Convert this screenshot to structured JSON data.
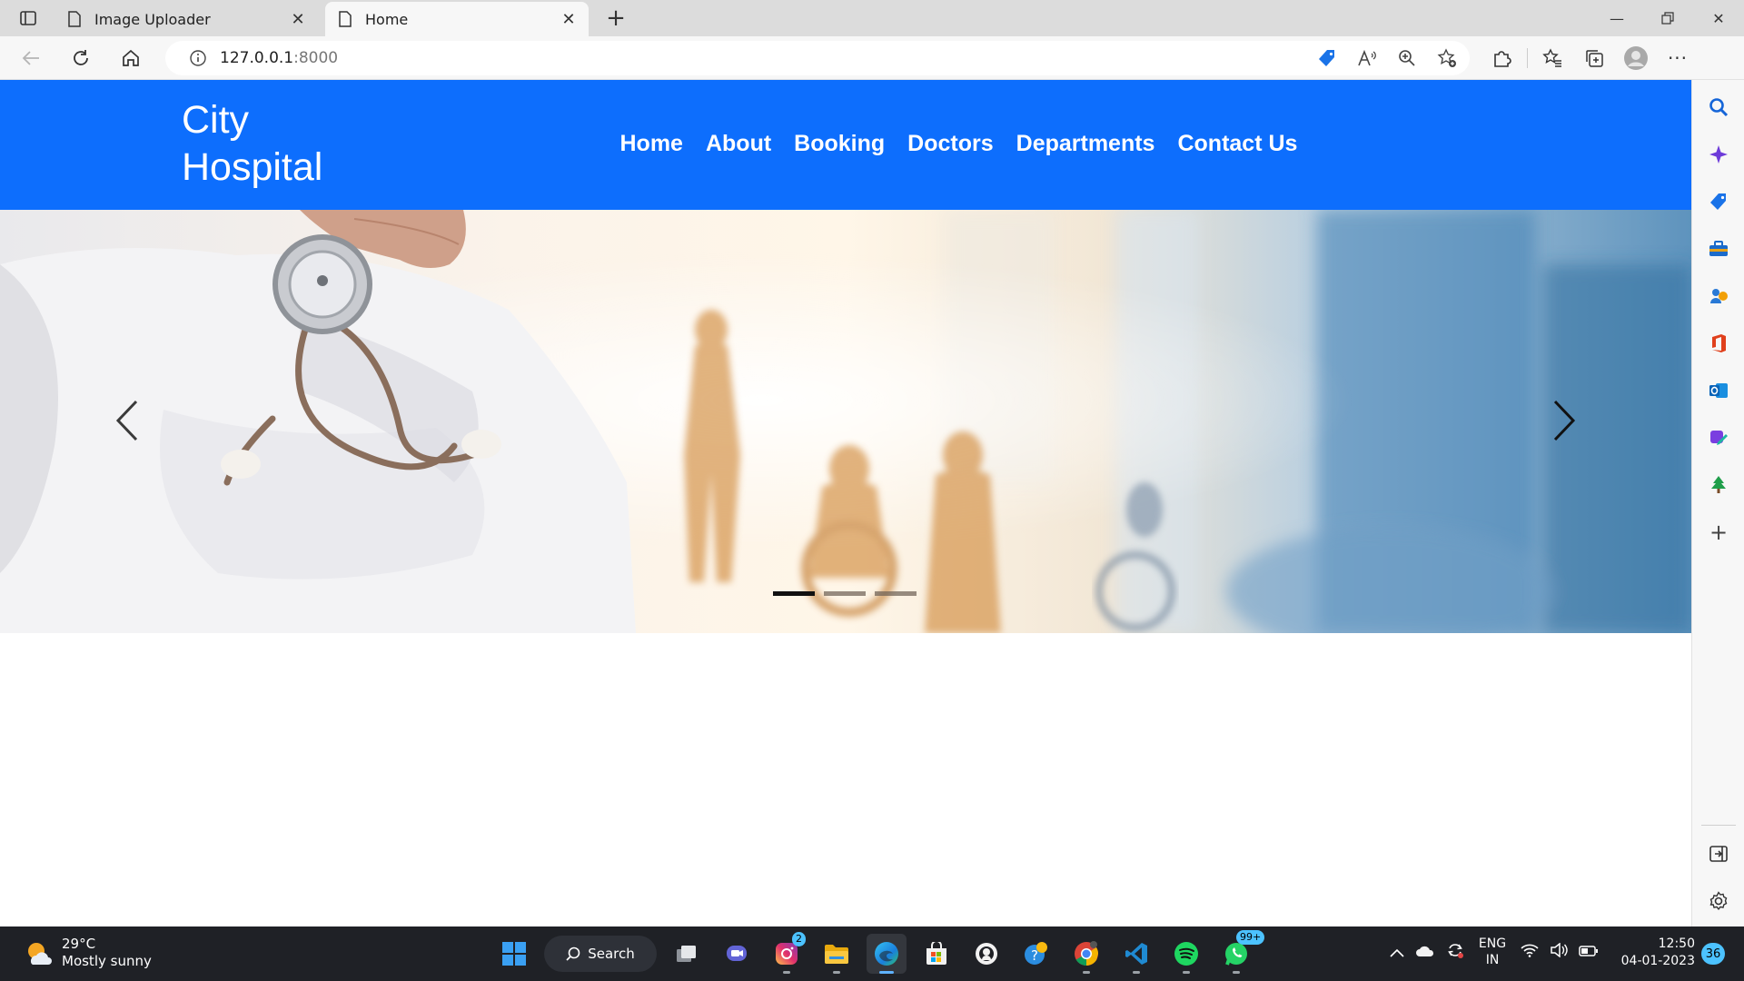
{
  "browser": {
    "tabs": [
      {
        "title": "Image Uploader",
        "active": false
      },
      {
        "title": "Home",
        "active": true
      }
    ],
    "address": {
      "host": "127.0.0.1",
      "port": ":8000"
    },
    "sidebar_icons": [
      "search-icon",
      "copilot-icon",
      "shopping-tag-icon",
      "tools-icon",
      "games-icon",
      "office-icon",
      "outlook-icon",
      "designer-icon",
      "tree-icon",
      "add-icon",
      "split-screen-icon",
      "settings-icon"
    ]
  },
  "site": {
    "brand_line1": "City",
    "brand_line2": "Hospital",
    "nav": [
      "Home",
      "About",
      "Booking",
      "Doctors",
      "Departments",
      "Contact Us"
    ],
    "accent": "#0d6efd",
    "carousel": {
      "slides": 3,
      "active_index": 0
    }
  },
  "taskbar": {
    "weather_temp": "29°C",
    "weather_desc": "Mostly sunny",
    "search_label": "Search",
    "badges": {
      "instagram": "2",
      "whatsapp": "99+"
    },
    "lang_line1": "ENG",
    "lang_line2": "IN",
    "time": "12:50",
    "date": "04-01-2023",
    "notifications": "36"
  }
}
